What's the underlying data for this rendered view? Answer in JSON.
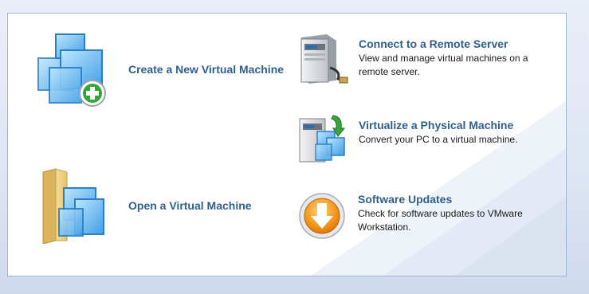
{
  "left_actions": [
    {
      "label": "Create a New Virtual Machine",
      "icon": "new-vm-icon"
    },
    {
      "label": "Open a Virtual Machine",
      "icon": "open-vm-folder-icon"
    }
  ],
  "right_actions": [
    {
      "title": "Connect to a Remote Server",
      "description": "View and manage virtual machines on a remote server.",
      "icon": "remote-server-icon"
    },
    {
      "title": "Virtualize a Physical Machine",
      "description": "Convert your PC to a virtual machine.",
      "icon": "virtualize-pc-icon"
    },
    {
      "title": "Software Updates",
      "description": "Check for software updates to VMware Workstation.",
      "icon": "software-update-icon"
    }
  ],
  "colors": {
    "link": "#2f5f8e",
    "border": "#9fb6d6",
    "background": "#dde5f3"
  }
}
